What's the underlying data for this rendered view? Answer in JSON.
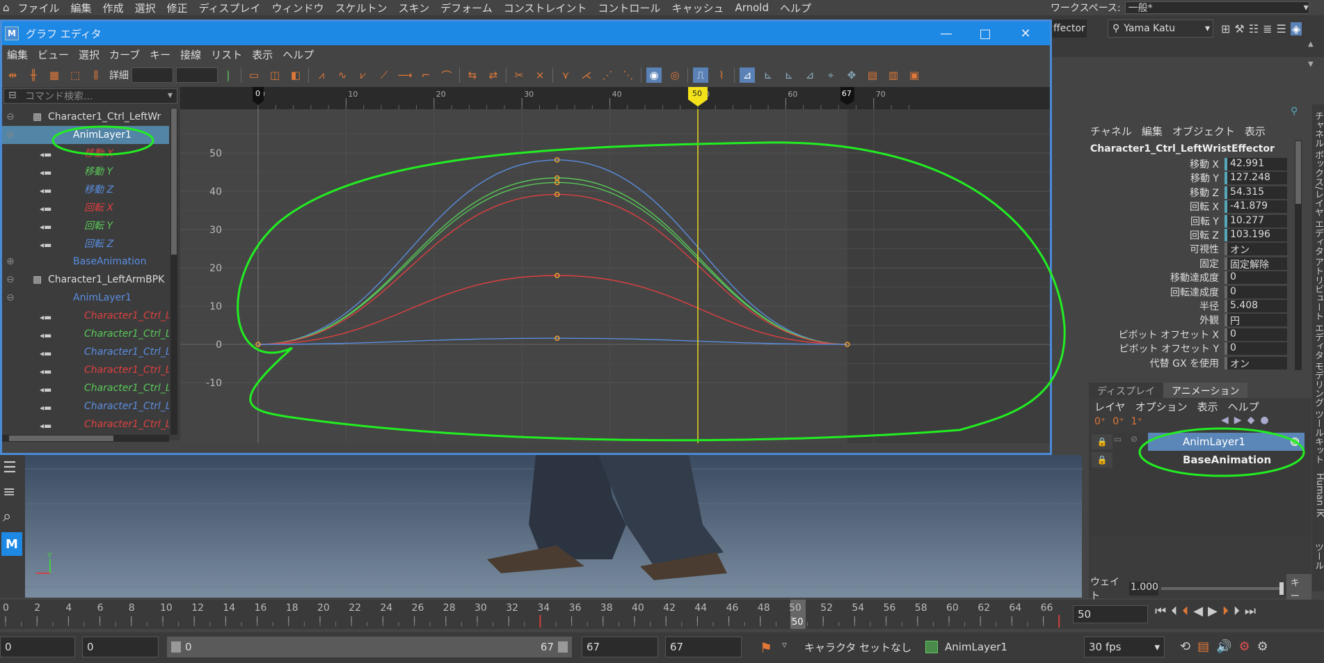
{
  "menubar": {
    "items": [
      "ファイル",
      "編集",
      "作成",
      "選択",
      "修正",
      "ディスプレイ",
      "ウィンドウ",
      "スケルトン",
      "スキン",
      "デフォーム",
      "コンストレイント",
      "コントロール",
      "キャッシュ",
      "Arnold",
      "ヘルプ"
    ],
    "workspace_label": "ワークスペース:",
    "workspace_value": "一般*"
  },
  "status_line": {
    "effector_partial": "ffector",
    "user_name": "Yama Katu"
  },
  "graph_editor": {
    "title": "グラフ エディタ",
    "menu": [
      "編集",
      "ビュー",
      "選択",
      "カーブ",
      "キー",
      "接線",
      "リスト",
      "表示",
      "ヘルプ"
    ],
    "detail_label": "詳細",
    "search_placeholder": "コマンド検索...",
    "outliner": [
      {
        "label": "Character1_Ctrl_LeftWr",
        "kind": "node",
        "color": "#dddddd"
      },
      {
        "label": "AnimLayer1",
        "kind": "layer",
        "color": "#ffffff",
        "selected": true
      },
      {
        "label": "移動 X",
        "kind": "curve",
        "color": "#e04040"
      },
      {
        "label": "移動 Y",
        "kind": "curve",
        "color": "#58c858"
      },
      {
        "label": "移動 Z",
        "kind": "curve",
        "color": "#5a8ee0"
      },
      {
        "label": "回転 X",
        "kind": "curve",
        "color": "#e04040"
      },
      {
        "label": "回転 Y",
        "kind": "curve",
        "color": "#58c858"
      },
      {
        "label": "回転 Z",
        "kind": "curve",
        "color": "#5a8ee0"
      },
      {
        "label": "BaseAnimation",
        "kind": "layer",
        "color": "#5a8ee0"
      },
      {
        "label": "Character1_LeftArmBPK",
        "kind": "node",
        "color": "#dddddd"
      },
      {
        "label": "AnimLayer1",
        "kind": "layer",
        "color": "#5a8ee0"
      },
      {
        "label": "Character1_Ctrl_Le",
        "kind": "curve",
        "color": "#e04040"
      },
      {
        "label": "Character1_Ctrl_Le",
        "kind": "curve",
        "color": "#58c858"
      },
      {
        "label": "Character1_Ctrl_Le",
        "kind": "curve",
        "color": "#5a8ee0"
      },
      {
        "label": "Character1_Ctrl_Le",
        "kind": "curve",
        "color": "#e04040"
      },
      {
        "label": "Character1_Ctrl_Le",
        "kind": "curve",
        "color": "#58c858"
      },
      {
        "label": "Character1_Ctrl_Le",
        "kind": "curve",
        "color": "#5a8ee0"
      },
      {
        "label": "Character1_Ctrl_Le",
        "kind": "curve",
        "color": "#e04040"
      }
    ],
    "ruler": {
      "ticks": [
        "0",
        "10",
        "20",
        "30",
        "40",
        "50",
        "60",
        "70"
      ],
      "start_marker": "0",
      "end_marker": "67",
      "current_marker": "50"
    },
    "yaxis": [
      "50",
      "40",
      "30",
      "20",
      "10",
      "0",
      "-10"
    ],
    "curve_colors": [
      "#5a8ee0",
      "#58c858",
      "#58c858",
      "#e04040",
      "#e04040",
      "#5a8ee0"
    ],
    "curve_peaks": [
      48.2,
      43.5,
      42.3,
      39.2,
      18.0,
      1.6
    ],
    "curve_end_frame": 67,
    "curve_key_frame": 34,
    "annotation_color": "#22ee22"
  },
  "channel_box": {
    "menu": [
      "チャネル",
      "編集",
      "オブジェクト",
      "表示"
    ],
    "object_name": "Character1_Ctrl_LeftWristEffector",
    "rows": [
      {
        "label": "移動 X",
        "value": "42.991",
        "keyed": true
      },
      {
        "label": "移動 Y",
        "value": "127.248",
        "keyed": true
      },
      {
        "label": "移動 Z",
        "value": "54.315",
        "keyed": true
      },
      {
        "label": "回転 X",
        "value": "-41.879",
        "keyed": true
      },
      {
        "label": "回転 Y",
        "value": "10.277",
        "keyed": true
      },
      {
        "label": "回転 Z",
        "value": "103.196",
        "keyed": true
      },
      {
        "label": "可視性",
        "value": "オン",
        "keyed": false
      },
      {
        "label": "固定",
        "value": "固定解除",
        "keyed": false
      },
      {
        "label": "移動達成度",
        "value": "0",
        "keyed": false
      },
      {
        "label": "回転達成度",
        "value": "0",
        "keyed": false
      },
      {
        "label": "半径",
        "value": "5.408",
        "keyed": false
      },
      {
        "label": "外観",
        "value": "円",
        "keyed": false
      },
      {
        "label": "ピボット オフセット X",
        "value": "0",
        "keyed": false
      },
      {
        "label": "ピボット オフセット Y",
        "value": "0",
        "keyed": false
      },
      {
        "label": "代替 GX を使用",
        "value": "オン",
        "keyed": false
      }
    ],
    "side_tabs": [
      "チャネル ボックス/レイヤ エディタ",
      "アトリビュート エディタ",
      "モデリング ツールキット",
      "Human IK",
      "ツール"
    ]
  },
  "layer_editor": {
    "tabs": [
      "ディスプレイ",
      "アニメーション"
    ],
    "menu": [
      "レイヤ",
      "オプション",
      "表示",
      "ヘルプ"
    ],
    "layers": [
      {
        "name": "AnimLayer1",
        "selected": true
      },
      {
        "name": "BaseAnimation",
        "selected": false
      }
    ],
    "weight_label": "ウェイト",
    "weight_value": "1.000",
    "key_button": "キー"
  },
  "timeline": {
    "ticks": [
      "0",
      "2",
      "4",
      "6",
      "8",
      "10",
      "12",
      "14",
      "16",
      "18",
      "20",
      "22",
      "24",
      "26",
      "28",
      "30",
      "32",
      "34",
      "36",
      "38",
      "40",
      "42",
      "44",
      "46",
      "48",
      "50",
      "52",
      "54",
      "56",
      "58",
      "60",
      "62",
      "64",
      "66"
    ],
    "current_frame_box": "50",
    "current_frame_label": "50"
  },
  "range_slider": {
    "start": "0",
    "anim_start": "0",
    "slider_start": "0",
    "slider_end": "67",
    "anim_end": "67",
    "end": "67",
    "character_set": "キャラクタ セットなし",
    "anim_layer": "AnimLayer1",
    "fps": "30 fps"
  },
  "viewport": {
    "axis_label": "Y"
  }
}
